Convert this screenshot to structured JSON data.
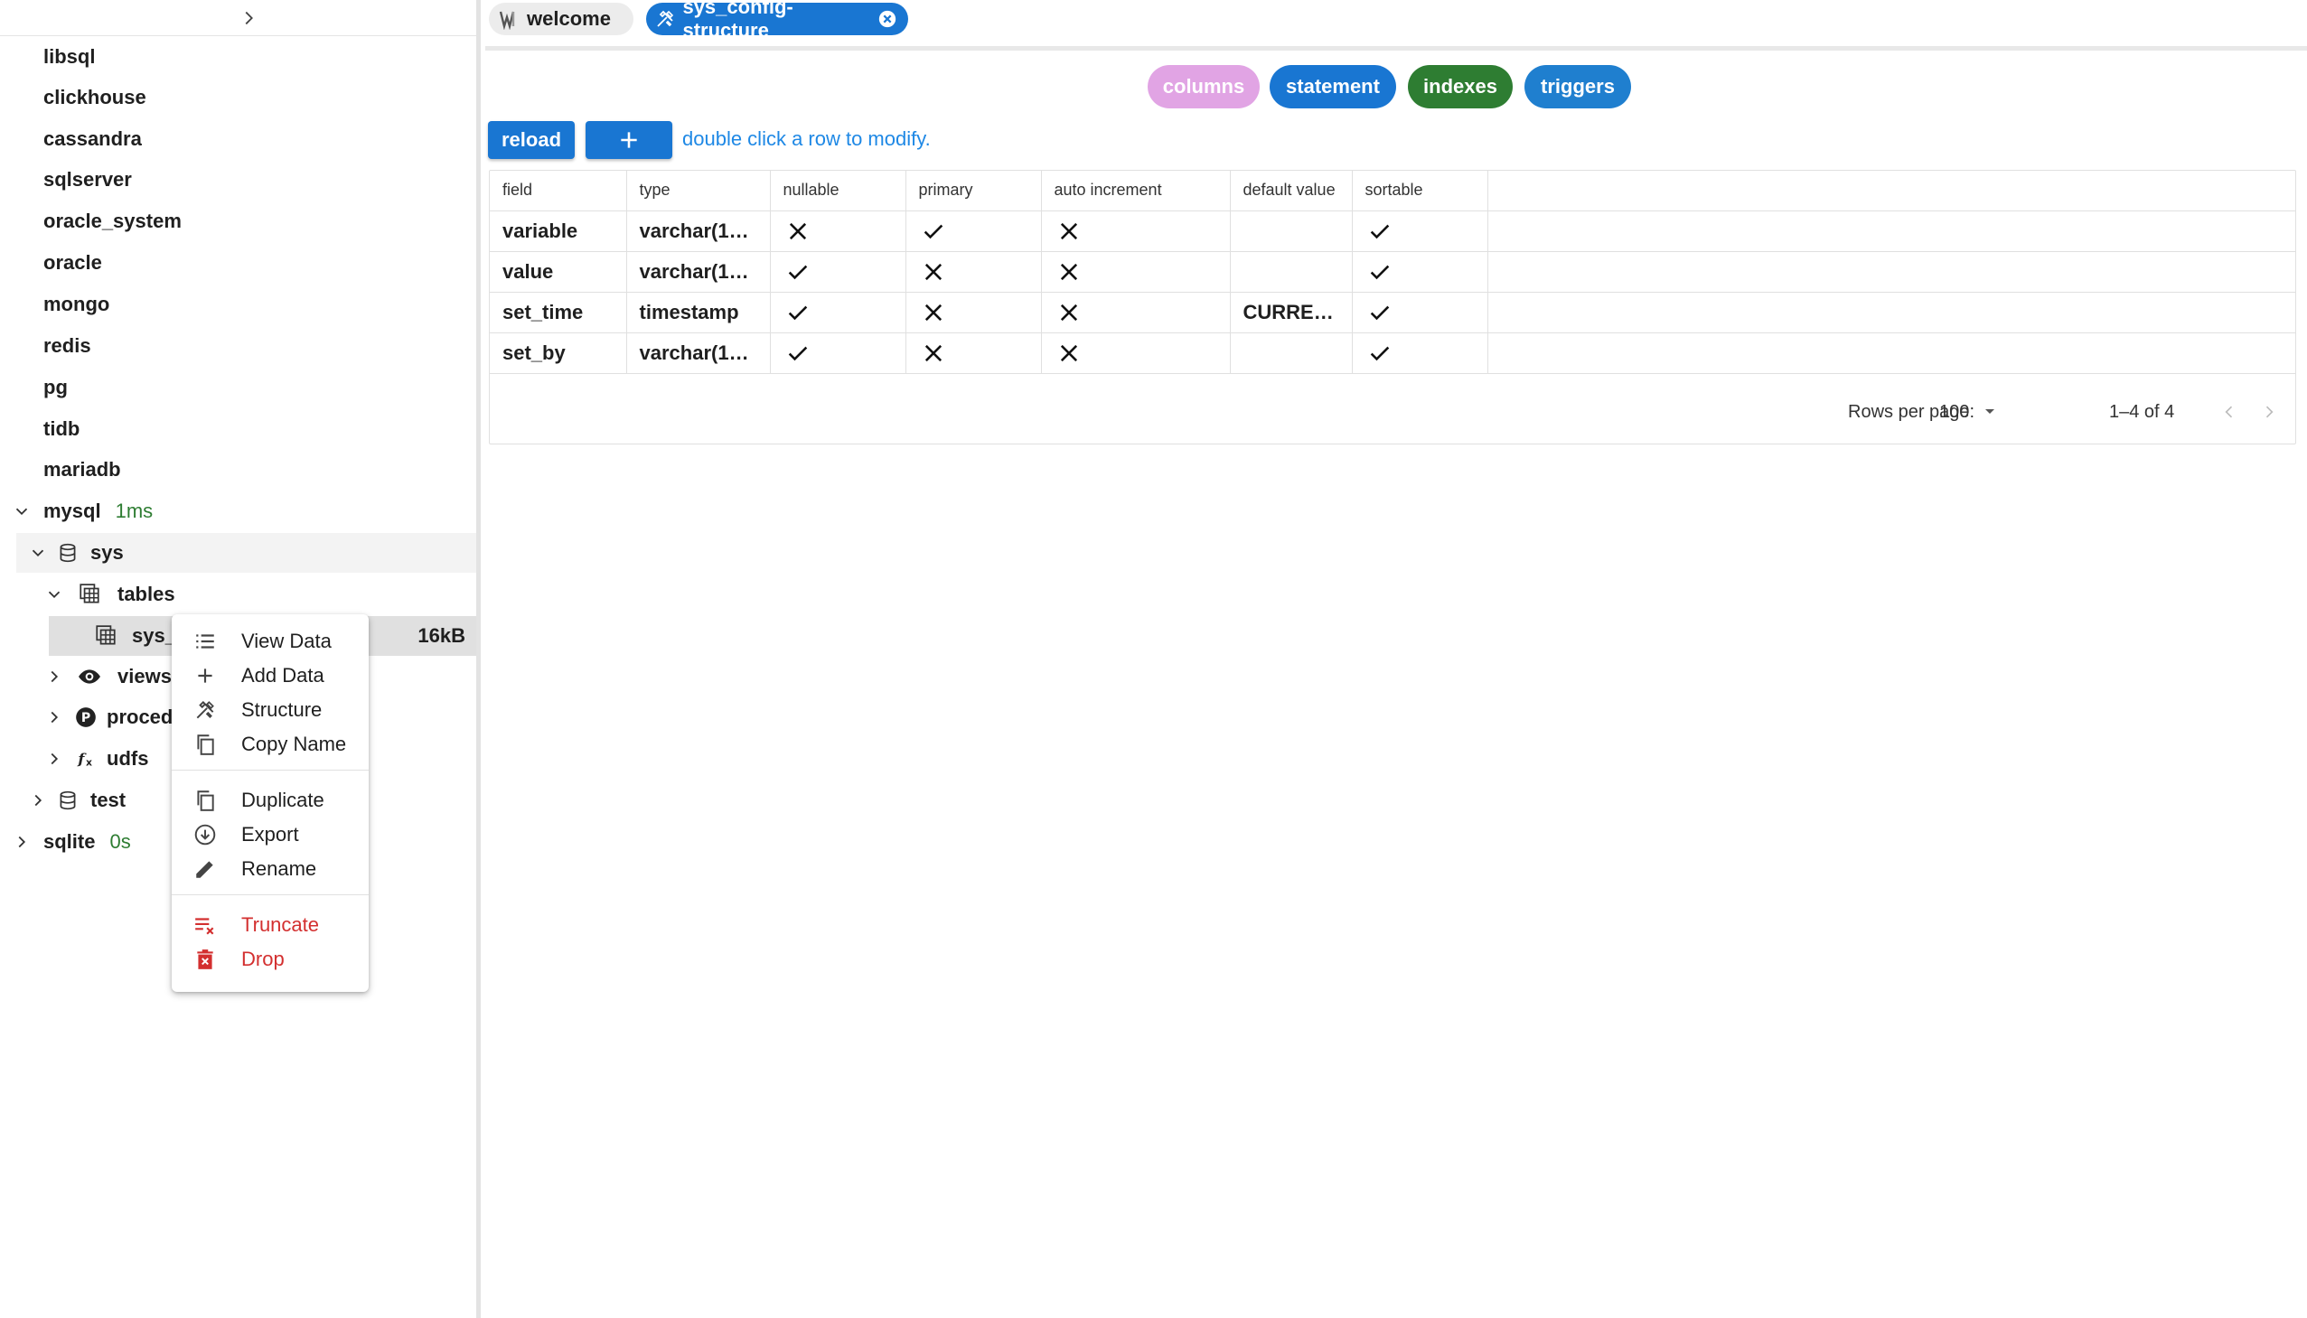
{
  "sidebar": {
    "connections": [
      {
        "label": "libsql"
      },
      {
        "label": "clickhouse"
      },
      {
        "label": "cassandra"
      },
      {
        "label": "sqlserver"
      },
      {
        "label": "oracle_system"
      },
      {
        "label": "oracle"
      },
      {
        "label": "mongo"
      },
      {
        "label": "redis"
      },
      {
        "label": "pg"
      },
      {
        "label": "tidb"
      },
      {
        "label": "mariadb"
      }
    ],
    "mysql": {
      "label": "mysql",
      "latency": "1ms"
    },
    "sys_db": {
      "label": "sys"
    },
    "tables_node": {
      "label": "tables"
    },
    "selected_table": {
      "label": "sys_",
      "size": "16kB"
    },
    "views_node": {
      "label": "views"
    },
    "procedures_node": {
      "label": "proced"
    },
    "udfs_node": {
      "label": "udfs"
    },
    "test_db": {
      "label": "test"
    },
    "sqlite": {
      "label": "sqlite",
      "latency": "0s"
    }
  },
  "context_menu": {
    "view_data": "View Data",
    "add_data": "Add Data",
    "structure": "Structure",
    "copy_name": "Copy Name",
    "duplicate": "Duplicate",
    "export": "Export",
    "rename": "Rename",
    "truncate": "Truncate",
    "drop": "Drop"
  },
  "tabs": {
    "welcome": "welcome",
    "structure": "sys_config-structure"
  },
  "chips": {
    "columns": "columns",
    "statement": "statement",
    "indexes": "indexes",
    "triggers": "triggers"
  },
  "toolbar": {
    "reload": "reload",
    "hint": "double click a row to modify."
  },
  "table": {
    "headers": {
      "field": "field",
      "type": "type",
      "nullable": "nullable",
      "primary": "primary",
      "auto_increment": "auto increment",
      "default_value": "default value",
      "sortable": "sortable"
    },
    "rows": [
      {
        "field": "variable",
        "type": "varchar(1…",
        "nullable": "no",
        "primary": "yes",
        "auto_increment": "no",
        "default_value": "",
        "sortable": "yes"
      },
      {
        "field": "value",
        "type": "varchar(1…",
        "nullable": "yes",
        "primary": "no",
        "auto_increment": "no",
        "default_value": "",
        "sortable": "yes"
      },
      {
        "field": "set_time",
        "type": "timestamp",
        "nullable": "yes",
        "primary": "no",
        "auto_increment": "no",
        "default_value": "CURRE…",
        "sortable": "yes"
      },
      {
        "field": "set_by",
        "type": "varchar(1…",
        "nullable": "yes",
        "primary": "no",
        "auto_increment": "no",
        "default_value": "",
        "sortable": "yes"
      }
    ]
  },
  "pagination": {
    "rows_per_page_label": "Rows per page:",
    "rows_per_page": "100",
    "range": "1–4 of 4"
  },
  "colors": {
    "primary": "#1976d2",
    "columns_chip": "#e1a4e4",
    "indexes_chip": "#2e7d32",
    "latency": "#2e7d32",
    "danger": "#d32f2f"
  }
}
